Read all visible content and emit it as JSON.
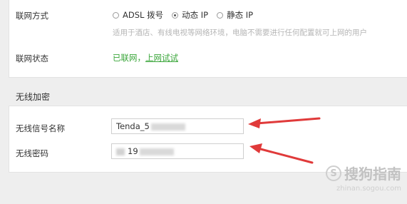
{
  "connection": {
    "label": "联网方式",
    "options": [
      {
        "label": "ADSL 拨号",
        "selected": false
      },
      {
        "label": "动态 IP",
        "selected": true
      },
      {
        "label": "静态 IP",
        "selected": false
      }
    ],
    "hint": "适用于酒店、有线电视等网络环境，电脑不需要进行任何配置就可上网的用户"
  },
  "status": {
    "label": "联网状态",
    "text": "已联网，",
    "link": "上网试试"
  },
  "wireless": {
    "section_title": "无线加密",
    "ssid_label": "无线信号名称",
    "ssid_value": "Tenda_5",
    "password_label": "无线密码",
    "password_value": "19"
  },
  "watermark": {
    "logo_text": "搜狗指南",
    "url": "zhinan.sogou.com"
  },
  "colors": {
    "link_green": "#3aa63a",
    "arrow_red": "#e03a3a"
  }
}
